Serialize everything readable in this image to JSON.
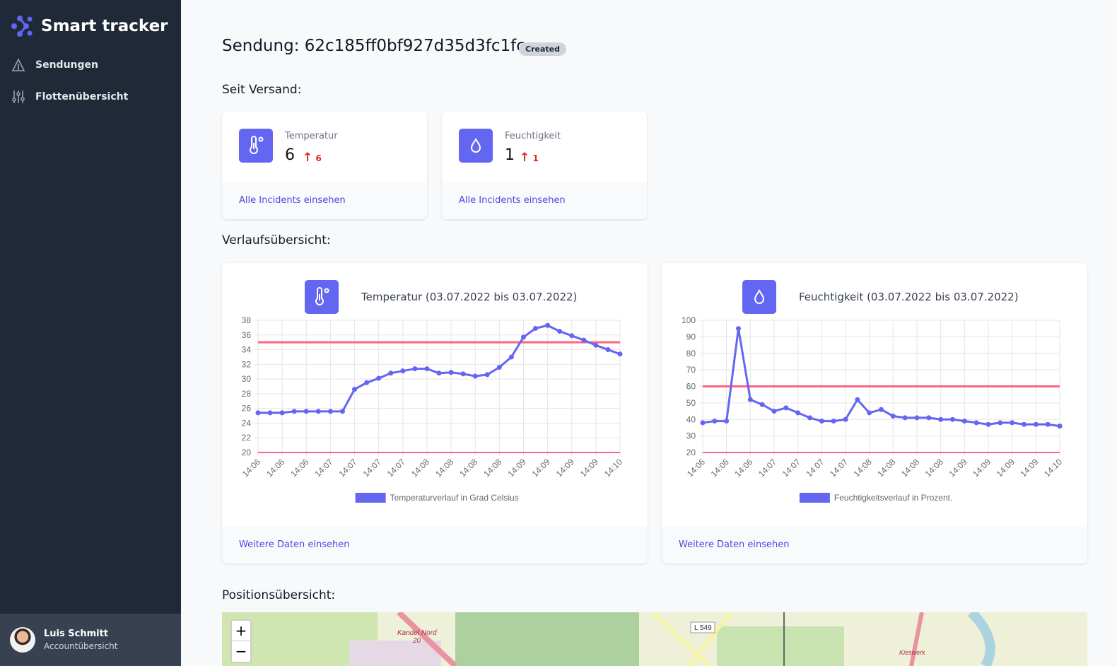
{
  "app": {
    "title": "Smart tracker",
    "brand_color": "#6366f1"
  },
  "sidebar": {
    "items": [
      {
        "label": "Sendungen",
        "icon": "warning-triangle-icon"
      },
      {
        "label": "Flottenübersicht",
        "icon": "sliders-icon"
      }
    ],
    "account": {
      "name": "Luis Schmitt",
      "subtitle": "Accountübersicht"
    }
  },
  "header": {
    "title": "Sendung: 62c185ff0bf927d35d3fc1fc",
    "status": "Created"
  },
  "since_shipping": {
    "heading": "Seit Versand:",
    "cards": [
      {
        "label": "Temperatur",
        "value": "6",
        "delta": "6",
        "icon": "thermometer-icon",
        "link": "Alle Incidents einsehen"
      },
      {
        "label": "Feuchtigkeit",
        "value": "1",
        "delta": "1",
        "icon": "droplet-icon",
        "link": "Alle Incidents einsehen"
      }
    ]
  },
  "history": {
    "heading": "Verlaufsübersicht:"
  },
  "chart_data": [
    {
      "type": "line",
      "title": "Temperatur (03.07.2022 bis 03.07.2022)",
      "legend": "Temperaturverlauf in Grad Celsius",
      "legend_placement": "bottom",
      "ylim": [
        20,
        38
      ],
      "yticks": [
        20,
        22,
        24,
        26,
        28,
        30,
        32,
        34,
        36,
        38
      ],
      "grid": true,
      "thresholds": [
        35,
        20
      ],
      "series_color": "#6366f1",
      "threshold_color": "#ff6384",
      "tick_labels": [
        "14:06",
        "14:06",
        "14:06",
        "14:07",
        "14:07",
        "14:07",
        "14:07",
        "14:08",
        "14:08",
        "14:08",
        "14:08",
        "14:09",
        "14:09",
        "14:09",
        "14:09",
        "14:10"
      ],
      "values": [
        25.4,
        25.4,
        25.4,
        25.6,
        25.6,
        25.6,
        25.6,
        25.6,
        28.6,
        29.5,
        30.1,
        30.8,
        31.1,
        31.4,
        31.4,
        30.8,
        30.9,
        30.7,
        30.4,
        30.6,
        31.6,
        33.0,
        35.7,
        36.9,
        37.3,
        36.5,
        35.9,
        35.3,
        34.6,
        34.0,
        33.4
      ],
      "link": "Weitere Daten einsehen"
    },
    {
      "type": "line",
      "title": "Feuchtigkeit (03.07.2022 bis 03.07.2022)",
      "legend": "Feuchtigkeitsverlauf in Prozent.",
      "legend_placement": "bottom",
      "ylim": [
        20,
        100
      ],
      "yticks": [
        20,
        30,
        40,
        50,
        60,
        70,
        80,
        90,
        100
      ],
      "grid": true,
      "thresholds": [
        60,
        20
      ],
      "series_color": "#6366f1",
      "threshold_color": "#ff6384",
      "tick_labels": [
        "14:06",
        "14:06",
        "14:06",
        "14:07",
        "14:07",
        "14:07",
        "14:07",
        "14:08",
        "14:08",
        "14:08",
        "14:08",
        "14:09",
        "14:09",
        "14:09",
        "14:09",
        "14:10"
      ],
      "values": [
        38,
        39,
        39,
        95,
        52,
        49,
        45,
        47,
        44,
        41,
        39,
        39,
        40,
        52,
        44,
        46,
        42,
        41,
        41,
        41,
        40,
        40,
        39,
        38,
        37,
        38,
        38,
        37,
        37,
        37,
        36
      ],
      "link": "Weitere Daten einsehen"
    }
  ],
  "position": {
    "heading": "Positionsübersicht:",
    "zoom_in": "+",
    "zoom_out": "−",
    "map_labels": [
      "Kandel Nord",
      "20",
      "L 549",
      "Kieswerk"
    ]
  }
}
